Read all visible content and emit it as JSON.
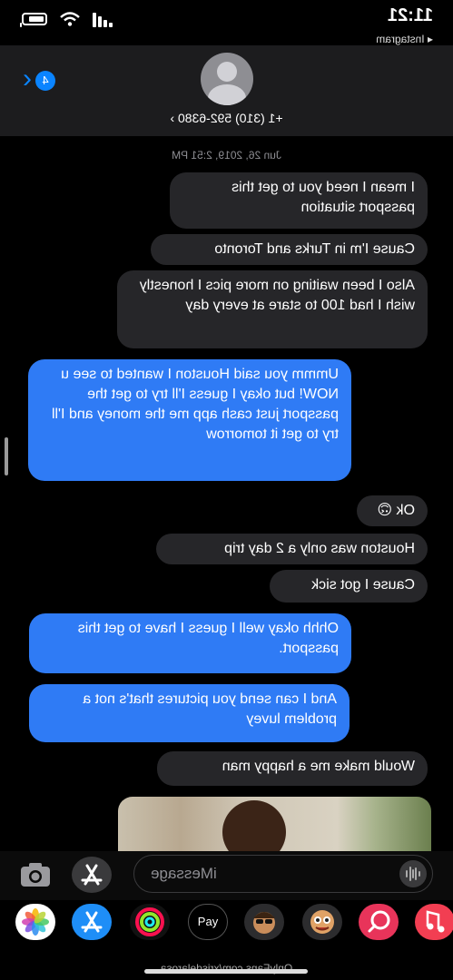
{
  "status_bar": {
    "time": "11:21",
    "back_app": "◂ Instagram"
  },
  "header": {
    "contact": "+1 (310) 592-6380 ›",
    "unread_badge": "4",
    "back_chevron": "‹"
  },
  "thread": {
    "timestamp": "Jun 26, 2019, 2:51 PM",
    "messages": [
      {
        "from": "them",
        "text": "I mean I need you to get this passport situation"
      },
      {
        "from": "them",
        "text": "Cause I'm in Turks and Toronto"
      },
      {
        "from": "them",
        "text": "Also I been waiting on more pics I honestly wish I had 100 to stare at every day"
      },
      {
        "from": "me",
        "text": "Ummm you said Houston I wanted to see u NOW! but okay I guess I'll try to get the passport just cash app me the money and I'll try to get it tomorrow"
      },
      {
        "from": "them",
        "text": "Ok 🙃"
      },
      {
        "from": "them",
        "text": "Houston was only a 2 day trip"
      },
      {
        "from": "them",
        "text": "Cause I got sick"
      },
      {
        "from": "me",
        "text": "Ohhh okay well I guess I have to get this passport."
      },
      {
        "from": "me",
        "text": "And I can send you pictures that's not a problem luvey"
      },
      {
        "from": "them",
        "text": "Would make me a happy man"
      }
    ]
  },
  "input": {
    "placeholder": "iMessage"
  },
  "app_tray": {
    "apps": [
      {
        "name": "photos-app-icon",
        "color": "#ffffff"
      },
      {
        "name": "app-store-icon",
        "color": "#1e8ef7"
      },
      {
        "name": "activity-icon",
        "color": "#111111"
      },
      {
        "name": "apple-pay-icon",
        "color": "#000000",
        "label": "Pay"
      },
      {
        "name": "memoji-icon",
        "color": "#2c2c2e"
      },
      {
        "name": "animoji-icon",
        "color": "#2c2c2e"
      },
      {
        "name": "search-images-icon",
        "color": "#e8345a"
      },
      {
        "name": "music-icon",
        "color": "#f23e52"
      }
    ]
  },
  "watermark": "OnlyFans.com/xrisdelarosa"
}
